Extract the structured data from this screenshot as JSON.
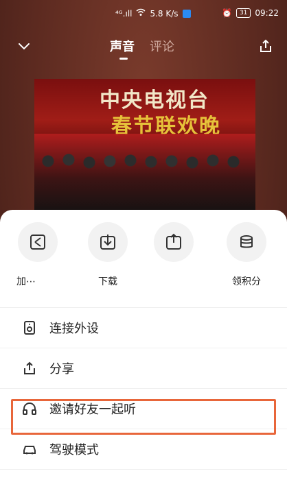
{
  "status": {
    "signal": "⁴ᴳ.ıll",
    "wifi": "WiFi",
    "speed": "5.8 K/s",
    "alarm": "⏰",
    "battery": "31",
    "time": "09:22"
  },
  "header": {
    "tabs": [
      "声音",
      "评论"
    ]
  },
  "cover": {
    "title_line1": "中央电视台",
    "title_line2": "春节联欢晚"
  },
  "sheet": {
    "actions": [
      {
        "label": "加⋯"
      },
      {
        "label": "下载"
      },
      {
        "label": ""
      },
      {
        "label": "领积分"
      }
    ],
    "menu": [
      {
        "label": "连接外设"
      },
      {
        "label": "分享"
      },
      {
        "label": "邀请好友一起听"
      },
      {
        "label": "驾驶模式"
      }
    ]
  },
  "colors": {
    "highlight": "#e8663a",
    "bg": "#5a2a1f"
  }
}
